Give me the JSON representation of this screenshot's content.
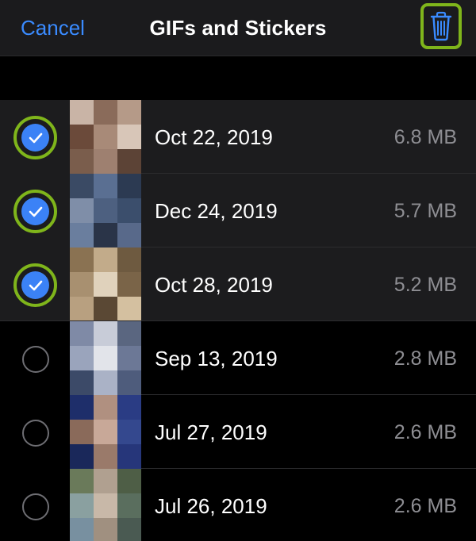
{
  "nav": {
    "cancel_label": "Cancel",
    "title": "GIFs and Stickers",
    "trash_icon": "trash-icon"
  },
  "colors": {
    "accent": "#3a8bff",
    "highlight_outline": "#7fb51b",
    "selected_row_bg": "#1c1c1e",
    "secondary_text": "#8e8e93"
  },
  "items": [
    {
      "date": "Oct 22, 2019",
      "size": "6.8 MB",
      "selected": true,
      "thumb": [
        "#c9b4a6",
        "#8a6b5a",
        "#b59a88",
        "#6b4a3a",
        "#a88a78",
        "#d8c6b8",
        "#7a5d4c",
        "#9e8070",
        "#5c4336"
      ]
    },
    {
      "date": "Dec 24, 2019",
      "size": "5.7 MB",
      "selected": true,
      "thumb": [
        "#3a4a64",
        "#5a6f92",
        "#2c3a52",
        "#7f8ea8",
        "#4d6080",
        "#3b4e6c",
        "#6a7e9e",
        "#2a3448",
        "#58698a"
      ]
    },
    {
      "date": "Oct 28, 2019",
      "size": "5.2 MB",
      "selected": true,
      "thumb": [
        "#8a7252",
        "#c2ab8a",
        "#6e5a40",
        "#a89070",
        "#e0d2bc",
        "#7a6448",
        "#b8a080",
        "#5a4834",
        "#d4c0a0"
      ]
    },
    {
      "date": "Sep 13, 2019",
      "size": "2.8 MB",
      "selected": false,
      "thumb": [
        "#7f8aa6",
        "#c8ccd8",
        "#5a6680",
        "#9aa4bc",
        "#e2e4ea",
        "#6c7896",
        "#3c4a68",
        "#aab2c6",
        "#4e5c7c"
      ]
    },
    {
      "date": "Jul 27, 2019",
      "size": "2.6 MB",
      "selected": false,
      "thumb": [
        "#1e2e6a",
        "#b09080",
        "#2a3c84",
        "#8a6a5a",
        "#c8a898",
        "#34488e",
        "#1a285a",
        "#9a7a6a",
        "#26367a"
      ]
    },
    {
      "date": "Jul 26, 2019",
      "size": "2.6 MB",
      "selected": false,
      "thumb": [
        "#6a7a5a",
        "#b0a090",
        "#4e5e46",
        "#8aa0a0",
        "#c8b8a8",
        "#5a6e5e",
        "#7890a0",
        "#a09080",
        "#4a5a52"
      ]
    }
  ]
}
